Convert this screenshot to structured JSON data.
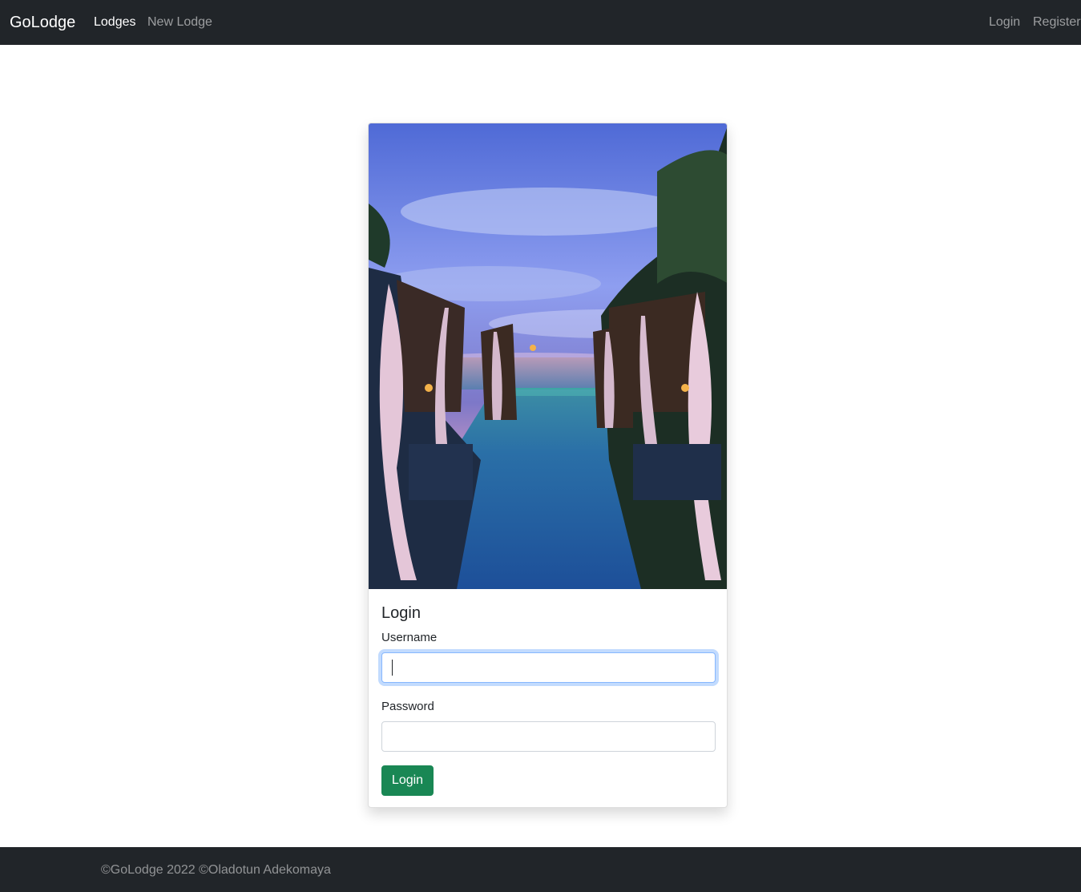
{
  "navbar": {
    "brand": "GoLodge",
    "links": [
      {
        "label": "Lodges"
      },
      {
        "label": "New Lodge"
      }
    ],
    "auth": [
      {
        "label": "Login"
      },
      {
        "label": "Register"
      }
    ]
  },
  "login_card": {
    "title": "Login",
    "username_label": "Username",
    "username_value": "",
    "password_label": "Password",
    "password_value": "",
    "submit_label": "Login"
  },
  "footer": {
    "text": "©GoLodge 2022 ©Oladotun Adekomaya"
  },
  "colors": {
    "navbar_bg": "#212529",
    "button_success": "#198754",
    "focus_ring": "#86b7fe"
  }
}
